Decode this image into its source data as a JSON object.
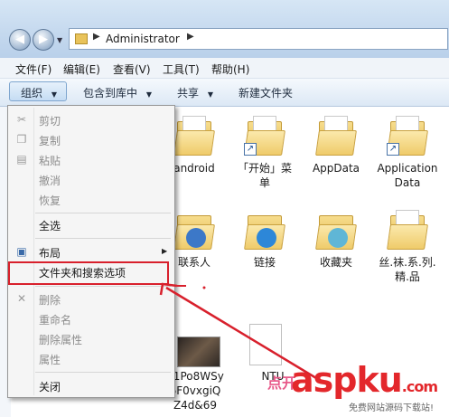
{
  "address": {
    "path": "Administrator"
  },
  "menubar": [
    "文件(F)",
    "编辑(E)",
    "查看(V)",
    "工具(T)",
    "帮助(H)"
  ],
  "toolbar": {
    "organize": "组织",
    "include_library": "包含到库中",
    "share": "共享",
    "new_folder": "新建文件夹"
  },
  "organize_menu": {
    "cut": "剪切",
    "copy": "复制",
    "paste": "粘贴",
    "undo": "撤消",
    "redo": "恢复",
    "select_all": "全选",
    "layout": "布局",
    "folder_options": "文件夹和搜索选项",
    "delete": "删除",
    "rename": "重命名",
    "remove_props": "删除属性",
    "properties": "属性",
    "close": "关闭"
  },
  "files": [
    {
      "name": "android",
      "icon": "folder-icon"
    },
    {
      "name": "「开始」菜单",
      "icon": "folder-shortcut-icon"
    },
    {
      "name": "AppData",
      "icon": "folder-icon"
    },
    {
      "name": "Application Data",
      "icon": "folder-shortcut-icon"
    },
    {
      "name": "联系人",
      "icon": "contacts-folder-icon"
    },
    {
      "name": "链接",
      "icon": "links-folder-icon"
    },
    {
      "name": "收藏夹",
      "icon": "favorites-folder-icon"
    },
    {
      "name": "丝.袜.系.列.精.品",
      "icon": "folder-icon"
    },
    {
      "name": "01Po8WSy6F0vxgiQZ4d&69",
      "icon": "image-thumbnail"
    },
    {
      "name": "NTU",
      "icon": "file-icon"
    }
  ],
  "watermark": {
    "pink": "点开",
    "logo": "aspku",
    "suffix": ".com",
    "sub": "免费网站源码下载站!"
  },
  "colors": {
    "highlight": "#d8202c",
    "menu_bg": "#f5f5f5",
    "toolbar_top": "#f5f9fd"
  }
}
